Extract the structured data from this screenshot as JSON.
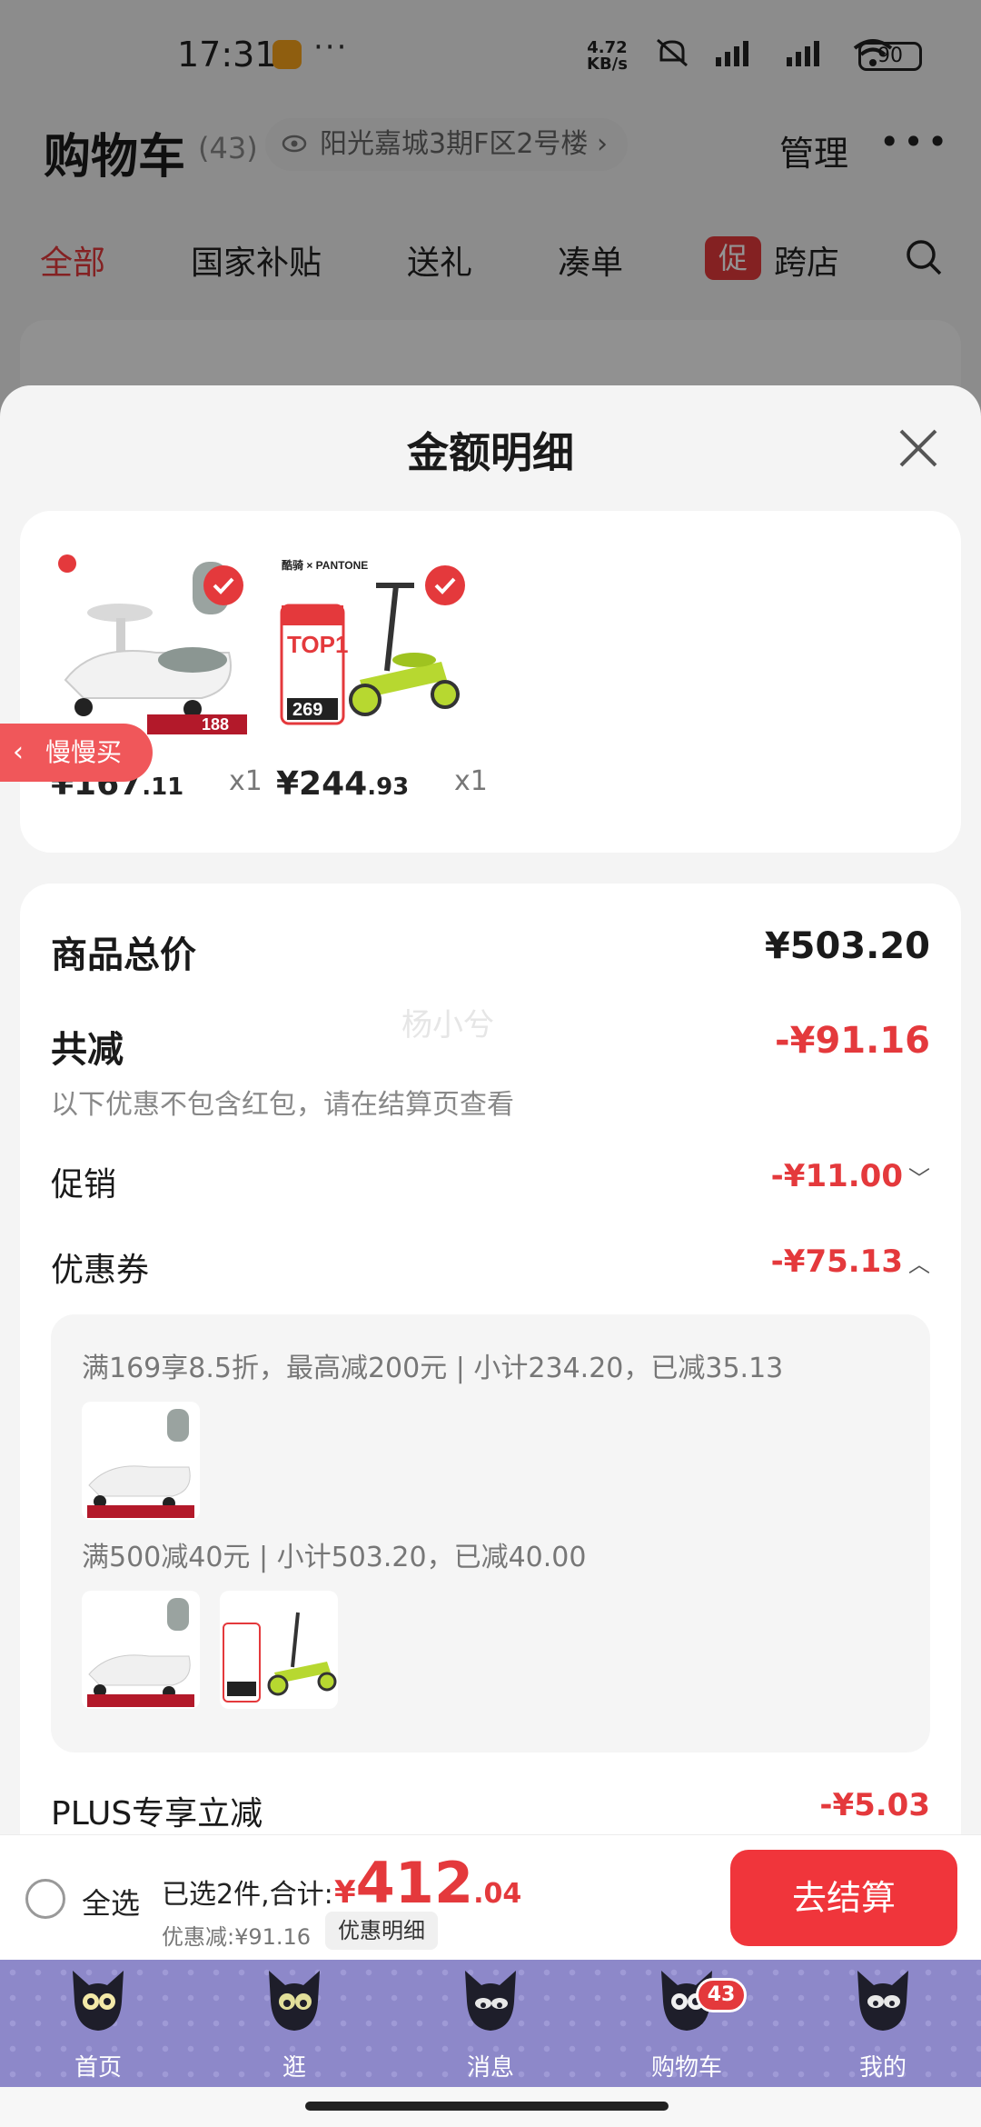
{
  "status": {
    "time": "17:31",
    "more": "···",
    "speed_value": "4.72",
    "speed_unit": "KB/s",
    "battery": "90"
  },
  "header": {
    "title": "购物车",
    "count": "(43)",
    "address": "阳光嘉城3期F区2号楼 ›",
    "manage": "管理",
    "more": "•••"
  },
  "tabs": [
    {
      "label": "全部"
    },
    {
      "label": "国家补贴"
    },
    {
      "label": "送礼"
    },
    {
      "label": "凑单"
    },
    {
      "badge": "促",
      "label": "跨店"
    }
  ],
  "sheet": {
    "title": "金额明细",
    "products": [
      {
        "icon": "balance-bike-icon",
        "price_int": "¥167",
        "price_dec": ".11",
        "qty": "x1",
        "tag": "188"
      },
      {
        "icon": "scooter-icon",
        "price_int": "¥244",
        "price_dec": ".93",
        "qty": "x1",
        "top": "TOP1",
        "tag": "269",
        "brand": "酷骑 × PANTONE"
      }
    ],
    "slow_buy": "慢慢买",
    "watermark": "杨小兮",
    "total_label": "商品总价",
    "total_value": "¥503.20",
    "reduce_label": "共减",
    "reduce_value": "-¥91.16",
    "reduce_note": "以下优惠不包含红包，请在结算页查看",
    "promo_label": "促销",
    "promo_value": "-¥11.00",
    "coupon_label": "优惠券",
    "coupon_value": "-¥75.13",
    "coupon_rules": [
      {
        "text": "满169享8.5折，最高减200元 | 小计234.20，已减35.13"
      },
      {
        "text": "满500减40元 | 小计503.20，已减40.00"
      }
    ],
    "plus_label": "PLUS专享立减",
    "plus_value": "-¥5.03"
  },
  "checkout": {
    "select_all": "全选",
    "selected": "已选2件,合计:",
    "sym": "¥",
    "amount": "412",
    "decimal": ".04",
    "discount": "优惠减:¥91.16",
    "detail_btn": "优惠明细",
    "pay": "去结算"
  },
  "nav": [
    {
      "label": "首页"
    },
    {
      "label": "逛"
    },
    {
      "label": "消息"
    },
    {
      "label": "购物车",
      "badge": "43"
    },
    {
      "label": "我的"
    }
  ],
  "colors": {
    "accent": "#e4393c",
    "nav_bg": "#8d88c9"
  }
}
